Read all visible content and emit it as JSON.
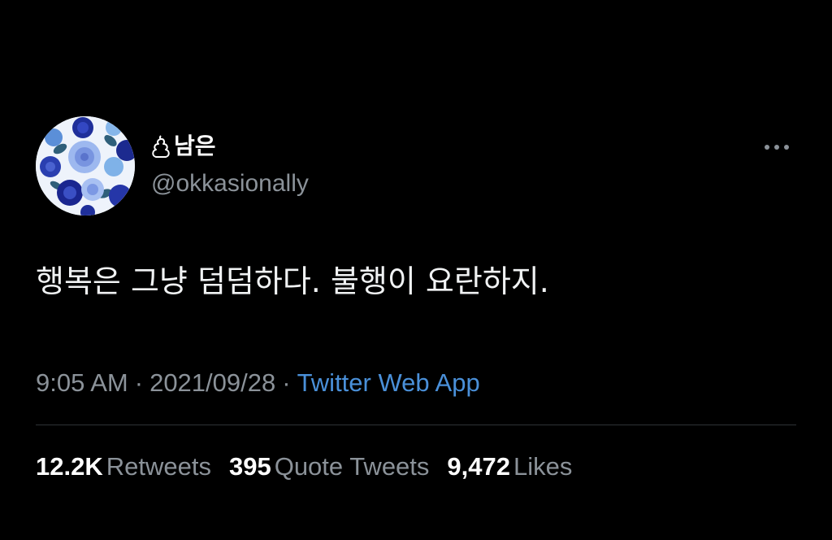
{
  "user": {
    "display_name": "남은",
    "name_emoji": "poop-emoji",
    "handle": "@okkasionally",
    "avatar": "blue-roses-pattern"
  },
  "tweet": {
    "text": "행복은 그냥 덤덤하다. 불행이 요란하지."
  },
  "meta": {
    "time": "9:05 AM",
    "separator": "·",
    "date": "2021/09/28",
    "source": "Twitter Web App"
  },
  "stats": {
    "retweets_count": "12.2K",
    "retweets_label": "Retweets",
    "quotes_count": "395",
    "quotes_label": "Quote Tweets",
    "likes_count": "9,472",
    "likes_label": "Likes"
  },
  "colors": {
    "background": "#000000",
    "text_primary": "#ffffff",
    "text_secondary": "#8b9299",
    "link": "#4a90d9",
    "divider": "#2f3336"
  }
}
